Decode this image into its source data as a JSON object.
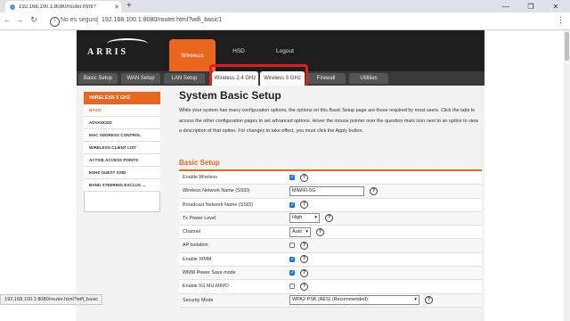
{
  "browser": {
    "tab_title": "192.168.100.1:8080/router.html?",
    "security_label": "No es seguro",
    "url": "192.168.100.1:8080/router.html?wifi_basic1",
    "status_url": "192.168.100.1:8080/router.html?wifi_basic"
  },
  "header": {
    "logo": "ARRIS",
    "nav": [
      "Wireless",
      "HSD",
      "Logout"
    ]
  },
  "subnav": {
    "tabs": [
      "Basic Setup",
      "WAN Setup",
      "LAN Setup",
      "Wireless 2.4 GHz",
      "Wireless 5 GHz",
      "Firewall",
      "Utilities"
    ]
  },
  "sidebar": {
    "heading": "WIRELESS 5 GHZ",
    "items": [
      "BASIC",
      "ADVANCED",
      "MAC ADDRESS CONTROL",
      "WIRELESS CLIENT LIST",
      "ACTIVE ACCESS POINTS",
      "5GHZ GUEST SSID",
      "BAND STEERING EXCLUS ..."
    ]
  },
  "main": {
    "title": "System Basic Setup",
    "description": "While your system has many configuration options, the options on this Basic Setup page are those required by most users. Click the tabs to access the other configuration pages to set advanced options. Hover the mouse pointer over the question mark icon next to an option to view a description of that option. For changes to take effect, you must click the Apply button.",
    "section": "Basic Setup",
    "fields": {
      "enable_wireless": "Enable Wireless",
      "ssid_label": "Wireless Network Name (SSID)",
      "ssid_value": "MIWIFI-5G",
      "broadcast": "Broadcast Network Name (SSID)",
      "tx_label": "Tx Power Level",
      "tx_value": "High",
      "channel_label": "Channel",
      "channel_value": "Auto",
      "ap_isolation": "AP Isolation",
      "enable_wmm": "Enable WMM",
      "wmm_power": "WMM Power Save mode",
      "mu_mimo": "Enable 5G MU-MIMO",
      "security_label": "Security Mode",
      "security_value": "WPA2-PSK (AES) (Recommended)"
    }
  }
}
